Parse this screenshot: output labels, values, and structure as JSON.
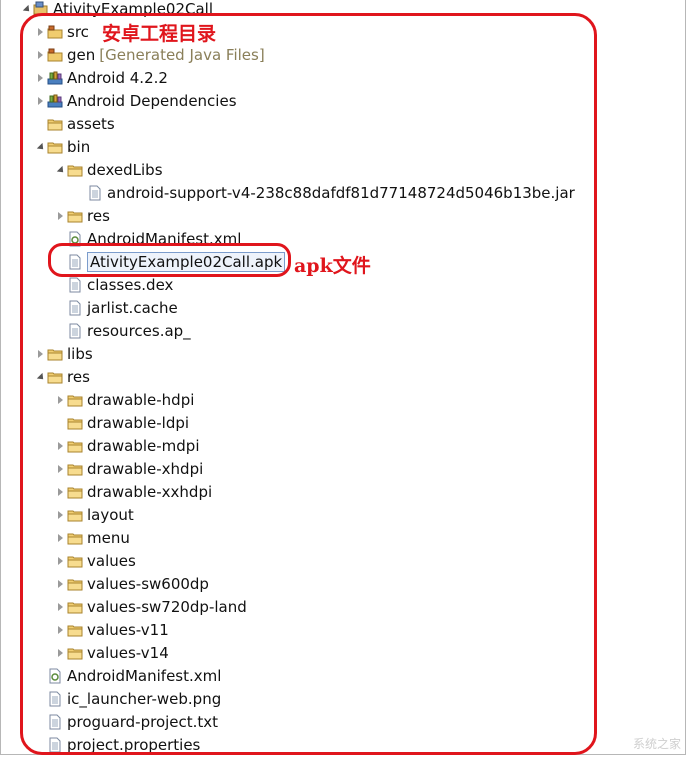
{
  "tree": {
    "items": [
      {
        "label": "AtivityExample02Call",
        "depth": 0,
        "expander": "down",
        "icon": "project"
      },
      {
        "label": "src",
        "depth": 1,
        "expander": "right",
        "icon": "src-folder"
      },
      {
        "label": "gen",
        "depth": 1,
        "expander": "right",
        "icon": "src-folder",
        "note": "[Generated Java Files]"
      },
      {
        "label": "Android 4.2.2",
        "depth": 1,
        "expander": "right",
        "icon": "library"
      },
      {
        "label": "Android Dependencies",
        "depth": 1,
        "expander": "right",
        "icon": "library"
      },
      {
        "label": "assets",
        "depth": 1,
        "expander": "none",
        "icon": "folder"
      },
      {
        "label": "bin",
        "depth": 1,
        "expander": "down",
        "icon": "folder"
      },
      {
        "label": "dexedLibs",
        "depth": 2,
        "expander": "down",
        "icon": "folder"
      },
      {
        "label": "android-support-v4-238c88dafdf81d77148724d5046b13be.jar",
        "depth": 3,
        "expander": "none",
        "icon": "file"
      },
      {
        "label": "res",
        "depth": 2,
        "expander": "right",
        "icon": "folder"
      },
      {
        "label": "AndroidManifest.xml",
        "depth": 2,
        "expander": "none",
        "icon": "xml-file"
      },
      {
        "label": "AtivityExample02Call.apk",
        "depth": 2,
        "expander": "none",
        "icon": "file",
        "selected": true
      },
      {
        "label": "classes.dex",
        "depth": 2,
        "expander": "none",
        "icon": "file"
      },
      {
        "label": "jarlist.cache",
        "depth": 2,
        "expander": "none",
        "icon": "file"
      },
      {
        "label": "resources.ap_",
        "depth": 2,
        "expander": "none",
        "icon": "file"
      },
      {
        "label": "libs",
        "depth": 1,
        "expander": "right",
        "icon": "folder"
      },
      {
        "label": "res",
        "depth": 1,
        "expander": "down",
        "icon": "folder"
      },
      {
        "label": "drawable-hdpi",
        "depth": 2,
        "expander": "right",
        "icon": "folder"
      },
      {
        "label": "drawable-ldpi",
        "depth": 2,
        "expander": "none",
        "icon": "folder"
      },
      {
        "label": "drawable-mdpi",
        "depth": 2,
        "expander": "right",
        "icon": "folder"
      },
      {
        "label": "drawable-xhdpi",
        "depth": 2,
        "expander": "right",
        "icon": "folder"
      },
      {
        "label": "drawable-xxhdpi",
        "depth": 2,
        "expander": "right",
        "icon": "folder"
      },
      {
        "label": "layout",
        "depth": 2,
        "expander": "right",
        "icon": "folder"
      },
      {
        "label": "menu",
        "depth": 2,
        "expander": "right",
        "icon": "folder"
      },
      {
        "label": "values",
        "depth": 2,
        "expander": "right",
        "icon": "folder"
      },
      {
        "label": "values-sw600dp",
        "depth": 2,
        "expander": "right",
        "icon": "folder"
      },
      {
        "label": "values-sw720dp-land",
        "depth": 2,
        "expander": "right",
        "icon": "folder"
      },
      {
        "label": "values-v11",
        "depth": 2,
        "expander": "right",
        "icon": "folder"
      },
      {
        "label": "values-v14",
        "depth": 2,
        "expander": "right",
        "icon": "folder"
      },
      {
        "label": "AndroidManifest.xml",
        "depth": 1,
        "expander": "none",
        "icon": "xml-file"
      },
      {
        "label": "ic_launcher-web.png",
        "depth": 1,
        "expander": "none",
        "icon": "file"
      },
      {
        "label": "proguard-project.txt",
        "depth": 1,
        "expander": "none",
        "icon": "file"
      },
      {
        "label": "project.properties",
        "depth": 1,
        "expander": "none",
        "icon": "file"
      }
    ]
  },
  "annotations": {
    "project_dir_label": "安卓工程目录",
    "apk_label": "apk文件",
    "color": "#e0151c"
  },
  "watermark": "系统之家"
}
